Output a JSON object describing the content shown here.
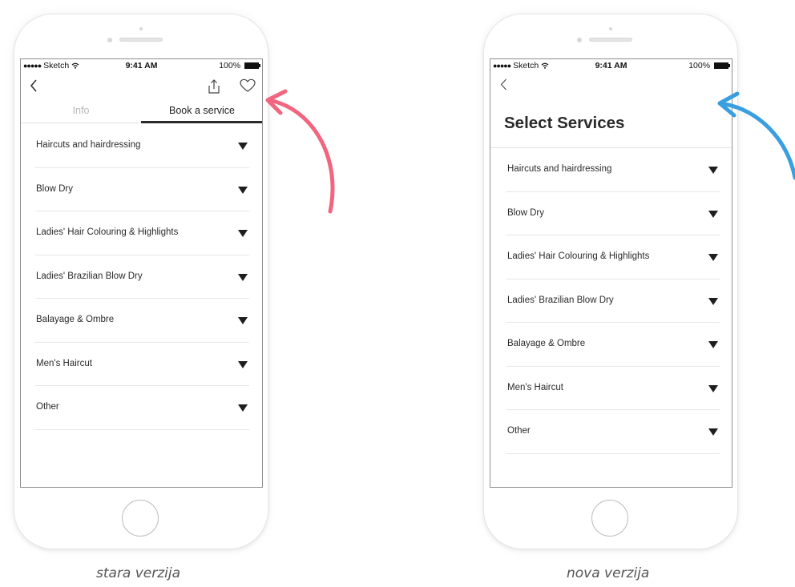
{
  "phones": {
    "old": {
      "status": {
        "carrier": "Sketch",
        "time": "9:41 AM",
        "battery": "100%"
      },
      "tabs": [
        {
          "label": "Info",
          "active": false
        },
        {
          "label": "Book a service",
          "active": true
        }
      ],
      "services": [
        "Haircuts and hairdressing",
        "Blow Dry",
        "Ladies' Hair Colouring & Highlights",
        "Ladies' Brazilian Blow Dry",
        "Balayage & Ombre",
        "Men's Haircut",
        "Other"
      ],
      "caption": "stara verzija"
    },
    "new": {
      "status": {
        "carrier": "Sketch",
        "time": "9:41 AM",
        "battery": "100%"
      },
      "title": "Select Services",
      "services": [
        "Haircuts and hairdressing",
        "Blow Dry",
        "Ladies' Hair Colouring & Highlights",
        "Ladies' Brazilian Blow Dry",
        "Balayage & Ombre",
        "Men's Haircut",
        "Other"
      ],
      "caption": "nova verzija"
    }
  },
  "colors": {
    "arrow_old": "#f2657f",
    "arrow_new": "#3a9fe0"
  },
  "icons": [
    "back-chevron-icon",
    "share-icon",
    "heart-icon",
    "dropdown-triangle-icon",
    "wifi-icon",
    "battery-icon"
  ]
}
